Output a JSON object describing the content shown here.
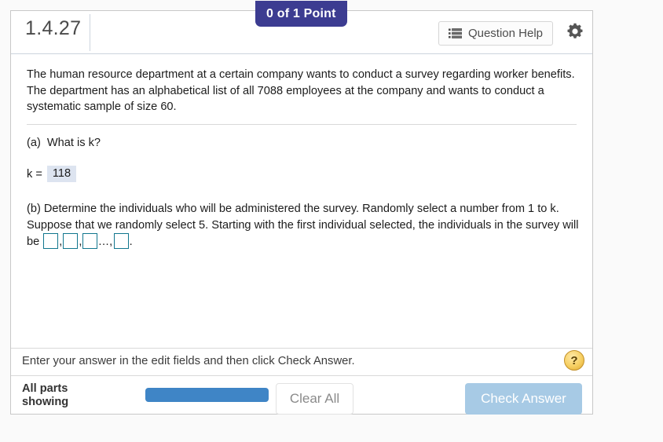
{
  "header": {
    "exercise_number": "1.4.27",
    "points_badge": "0 of 1 Point",
    "question_help_label": "Question Help",
    "list_icon": "list-icon",
    "gear_icon": "gear-icon",
    "badge_color": "#3c3c91"
  },
  "question": {
    "intro": "The human resource department at a certain company wants to conduct a survey regarding worker benefits. The department has an alphabetical list of all 7088 employees at the company and wants to conduct a systematic sample of size 60.",
    "part_a": {
      "label": "(a)",
      "text": "What is k?",
      "answer_prefix": "k =",
      "answer_value": "118"
    },
    "part_b": {
      "label": "(b)",
      "text": "Determine the individuals who will be administered the survey.  Randomly select a number from 1 to k.  Suppose that we randomly select 5.  Starting with the first individual selected, the individuals in the survey will be",
      "blank_1": "",
      "blank_2": "",
      "blank_3": "",
      "blank_4": "",
      "separator_1": ",",
      "separator_2": ",",
      "separator_3": "...,",
      "terminator": "."
    }
  },
  "instruction": {
    "text": "Enter your answer in the edit fields and then click Check Answer.",
    "help_icon_label": "?"
  },
  "footer": {
    "all_parts_label": "All parts showing",
    "progress_percent": 100,
    "progress_color": "#3f85c6",
    "clear_all_label": "Clear All",
    "check_answer_label": "Check Answer",
    "check_answer_color": "#a7cae5"
  }
}
